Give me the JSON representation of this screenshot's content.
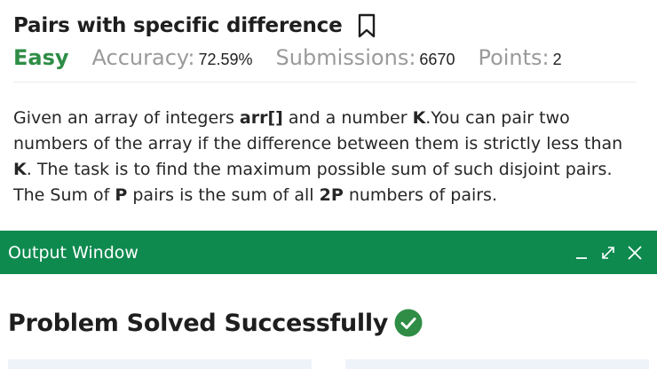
{
  "problem": {
    "title": "Pairs with specific difference",
    "difficulty": "Easy",
    "accuracy_label": "Accuracy:",
    "accuracy_value": "72.59%",
    "submissions_label": "Submissions:",
    "submissions_value": "6670",
    "points_label": "Points:",
    "points_value": "2",
    "description": {
      "p1": "Given an array of integers ",
      "b1": "arr[]",
      "p2": " and a number ",
      "b2": "K",
      "p3": ".You can pair two numbers of the array if the difference between them is strictly less than ",
      "b3": "K",
      "p4": ". The task is to find the maximum possible sum of such disjoint pairs. The Sum of ",
      "b4": "P",
      "p5": " pairs is the sum of all ",
      "b5": "2P",
      "p6": " numbers of pairs."
    }
  },
  "output_window": {
    "title": "Output Window",
    "icons": [
      "minimize-icon",
      "expand-icon",
      "close-icon"
    ]
  },
  "result": {
    "message": "Problem Solved Successfully",
    "icon": "check-circle-icon"
  },
  "colors": {
    "accent": "#2f8d46",
    "output_bar": "#0e8a4f"
  }
}
